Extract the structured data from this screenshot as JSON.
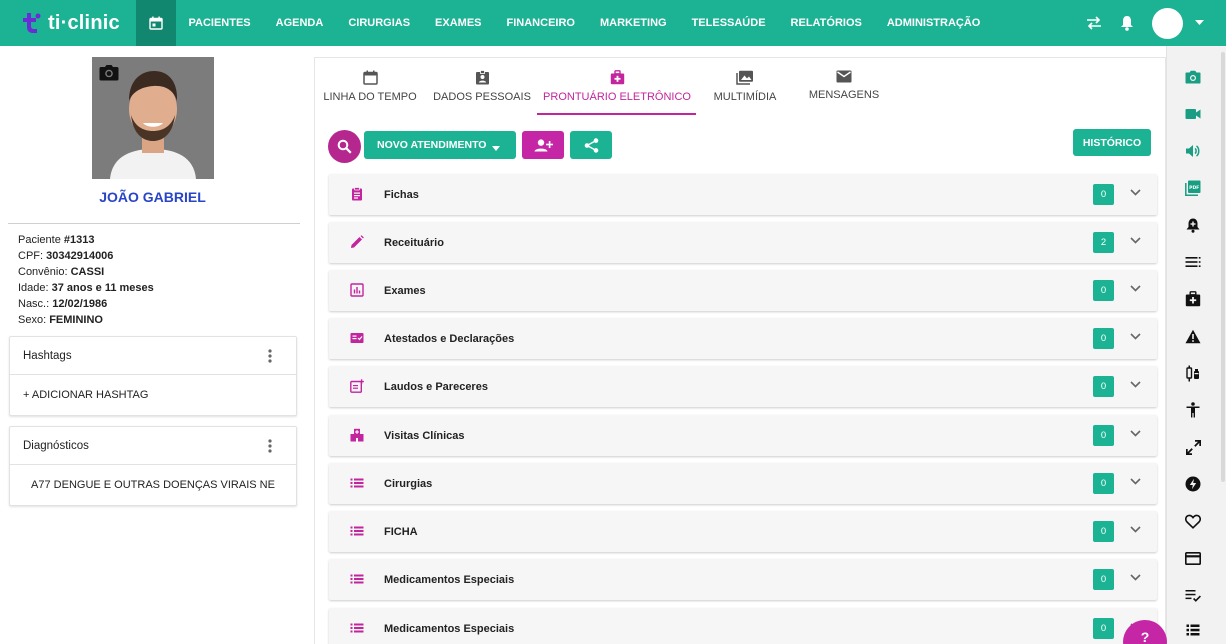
{
  "brand": {
    "name": "ti·clinic"
  },
  "nav": [
    "PACIENTES",
    "AGENDA",
    "CIRURGIAS",
    "EXAMES",
    "FINANCEIRO",
    "MARKETING",
    "TELESSAÚDE",
    "RELATÓRIOS",
    "ADMINISTRAÇÃO"
  ],
  "patient": {
    "name": "JOÃO GABRIEL",
    "info": [
      {
        "label": "Paciente ",
        "value": "#1313"
      },
      {
        "label": "CPF: ",
        "value": "30342914006"
      },
      {
        "label": "Convênio: ",
        "value": "CASSI"
      },
      {
        "label": "Idade: ",
        "value": "37 anos e 11 meses"
      },
      {
        "label": "Nasc.: ",
        "value": "12/02/1986"
      },
      {
        "label": "Sexo: ",
        "value": "FEMININO"
      }
    ]
  },
  "hashtags": {
    "title": "Hashtags",
    "add_label": "+ ADICIONAR HASHTAG"
  },
  "diagnosticos": {
    "title": "Diagnósticos",
    "item": "A77 DENGUE E OUTRAS DOENÇAS VIRAIS NE"
  },
  "tabs": [
    "LINHA DO TEMPO",
    "DADOS PESSOAIS",
    "PRONTUÁRIO ELETRÔNICO",
    "MULTIMÍDIA",
    "MENSAGENS"
  ],
  "active_tab": "PRONTUÁRIO ELETRÔNICO",
  "toolbar": {
    "novo_label": "NOVO ATENDIMENTO",
    "historico_label": "HISTÓRICO"
  },
  "sections": [
    {
      "label": "Fichas",
      "count": "0",
      "icon": "clipboard-icon"
    },
    {
      "label": "Receituário",
      "count": "2",
      "icon": "pencil-icon"
    },
    {
      "label": "Exames",
      "count": "0",
      "icon": "bar-chart-icon"
    },
    {
      "label": "Atestados e Declarações",
      "count": "0",
      "icon": "certificate-icon"
    },
    {
      "label": "Laudos e Pareceres",
      "count": "0",
      "icon": "report-add-icon"
    },
    {
      "label": "Visitas Clínicas",
      "count": "0",
      "icon": "hospital-icon"
    },
    {
      "label": "Cirurgias",
      "count": "0",
      "icon": "list-icon"
    },
    {
      "label": "FICHA",
      "count": "0",
      "icon": "list-icon"
    },
    {
      "label": "Medicamentos Especiais",
      "count": "0",
      "icon": "list-icon"
    },
    {
      "label": "Medicamentos Especiais",
      "count": "0",
      "icon": "list-icon"
    }
  ],
  "help": {
    "label": "?"
  },
  "colors": {
    "primary": "#1cb394",
    "accent": "#c2259d",
    "name": "#2844c7"
  },
  "rightbar_icons": [
    "camera-icon",
    "video-icon",
    "volume-icon",
    "pdf-icon",
    "alarm-add-icon",
    "list-icon",
    "medical-bag-icon",
    "warning-icon",
    "syringe-icon",
    "accessibility-icon",
    "expand-icon",
    "bolt-icon",
    "heart-icon",
    "credit-card-icon",
    "checklist-icon",
    "list-icon"
  ]
}
